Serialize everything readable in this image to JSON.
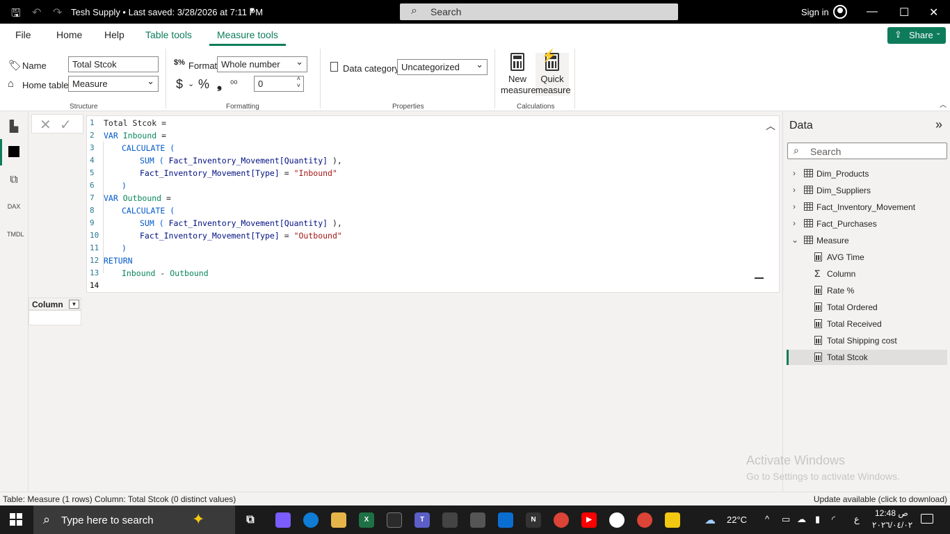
{
  "titlebar": {
    "title": "Tesh Supply • Last saved: 3/28/2026 at 7:11 PM",
    "search_placeholder": "Search",
    "signin": "Sign in"
  },
  "tabs": [
    {
      "label": "File"
    },
    {
      "label": "Home"
    },
    {
      "label": "Help"
    },
    {
      "label": "Table tools"
    },
    {
      "label": "Measure tools"
    }
  ],
  "share_label": "Share",
  "ribbon": {
    "name_label": "Name",
    "name_value": "Total Stcok",
    "home_table_label": "Home table",
    "home_table_value": "Measure",
    "structure_label": "Structure",
    "format_label": "Format",
    "format_value": "Whole number",
    "currency_symbol": "$",
    "percent_symbol": "%",
    "comma_symbol": "❟",
    "decimals_value": "0",
    "formatting_label": "Formatting",
    "data_category_label": "Data category",
    "data_category_value": "Uncategorized",
    "properties_label": "Properties",
    "new_measure_line1": "New",
    "new_measure_line2": "measure",
    "quick_measure_line1": "Quick",
    "quick_measure_line2": "measure",
    "calculations_label": "Calculations"
  },
  "rail": {
    "dax_label": "DAX",
    "tmdl_label": "TMDL"
  },
  "editor": {
    "line_numbers": [
      "1",
      "2",
      "3",
      "4",
      "5",
      "6",
      "7",
      "8",
      "9",
      "10",
      "11",
      "12",
      "13",
      "14"
    ],
    "l1": "Total Stcok =",
    "l2_kw": "VAR",
    "l2_var": "Inbound",
    "l2_eq": " =",
    "l3_fn": "CALCULATE (",
    "l4_fn": "SUM (",
    "l4_ref": "Fact_Inventory_Movement[Quantity]",
    "l4_end": " ),",
    "l5_ref": "Fact_Inventory_Movement[Type]",
    "l5_eq": " = ",
    "l5_str": "\"Inbound\"",
    "l6": ")",
    "l7_kw": "VAR",
    "l7_var": "Outbound",
    "l7_eq": " =",
    "l8_fn": "CALCULATE (",
    "l9_fn": "SUM (",
    "l9_ref": "Fact_Inventory_Movement[Quantity]",
    "l9_end": " ),",
    "l10_ref": "Fact_Inventory_Movement[Type]",
    "l10_eq": " = ",
    "l10_str": "\"Outbound\"",
    "l11": ")",
    "l12_kw": "RETURN",
    "l13_a": "Inbound",
    "l13_op": " - ",
    "l13_b": "Outbound"
  },
  "column_table": {
    "header": "Column"
  },
  "data_pane": {
    "title": "Data",
    "search_placeholder": "Search",
    "tables": [
      {
        "label": "Dim_Products"
      },
      {
        "label": "Dim_Suppliers"
      },
      {
        "label": "Fact_Inventory_Movement"
      },
      {
        "label": "Fact_Purchases"
      },
      {
        "label": "Measure"
      }
    ],
    "measures": [
      {
        "label": "AVG Time"
      },
      {
        "label": "Column"
      },
      {
        "label": "Rate %"
      },
      {
        "label": "Total Ordered"
      },
      {
        "label": "Total Received"
      },
      {
        "label": "Total Shipping cost"
      },
      {
        "label": "Total Stcok"
      }
    ]
  },
  "watermark": {
    "line1": "Activate Windows",
    "line2": "Go to Settings to activate Windows."
  },
  "statusbar": {
    "left": "Table: Measure (1 rows) Column: Total Stcok (0 distinct values)",
    "right": "Update available (click to download)"
  },
  "taskbar": {
    "search_placeholder": "Type here to search",
    "temperature": "22°C",
    "time": "12:48 ص",
    "date": "٢٠٢٦/٠٤/٠٢",
    "lang": "ع"
  },
  "colors": {
    "accent": "#0e7c5a",
    "keyword": "#035aca",
    "string": "#a31515",
    "variable": "#098658"
  }
}
